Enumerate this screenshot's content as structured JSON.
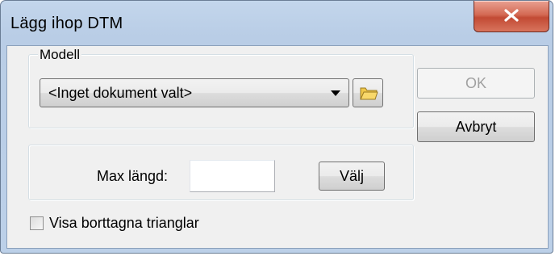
{
  "window": {
    "title": "Lägg ihop DTM"
  },
  "model_group": {
    "legend": "Modell",
    "document_select": {
      "selected": "<Inget dokument valt>"
    }
  },
  "buttons": {
    "ok": "OK",
    "cancel": "Avbryt",
    "choose": "Välj"
  },
  "max_length": {
    "label": "Max längd:",
    "value": ""
  },
  "show_removed": {
    "label": "Visa borttagna trianglar",
    "checked": false
  },
  "icons": {
    "close": "close-icon",
    "browse": "folder-icon",
    "dropdown": "chevron-down-icon"
  }
}
